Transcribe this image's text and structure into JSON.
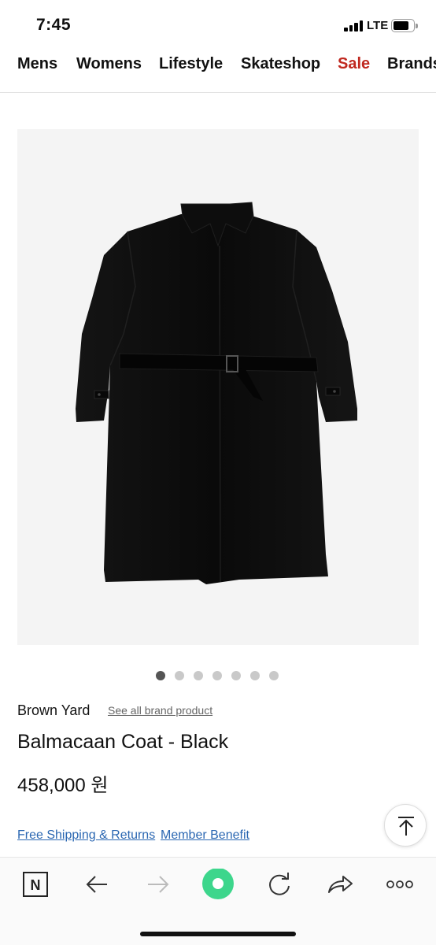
{
  "status_bar": {
    "time": "7:45",
    "network": "LTE",
    "battery_level": 0.68
  },
  "top_nav": {
    "items": [
      {
        "label": "Mens"
      },
      {
        "label": "Womens"
      },
      {
        "label": "Lifestyle"
      },
      {
        "label": "Skateshop"
      },
      {
        "label": "Sale"
      },
      {
        "label": "Brands"
      }
    ],
    "sale_color": "#c0281f"
  },
  "carousel": {
    "dot_count": 7,
    "active_index": 0
  },
  "product": {
    "brand": "Brown Yard",
    "brand_link": "See all brand product",
    "title": "Balmacaan Coat - Black",
    "price": "458,000 원"
  },
  "info_links": {
    "shipping": "Free Shipping & Returns",
    "member": "Member Benefit"
  },
  "link_color": "#2b67b2",
  "toolbar": {
    "icons": [
      "naver-home-icon",
      "back-arrow-icon",
      "forward-arrow-icon",
      "green-dot-icon",
      "refresh-icon",
      "share-icon",
      "more-icon"
    ],
    "accent": "#3dd68c"
  }
}
